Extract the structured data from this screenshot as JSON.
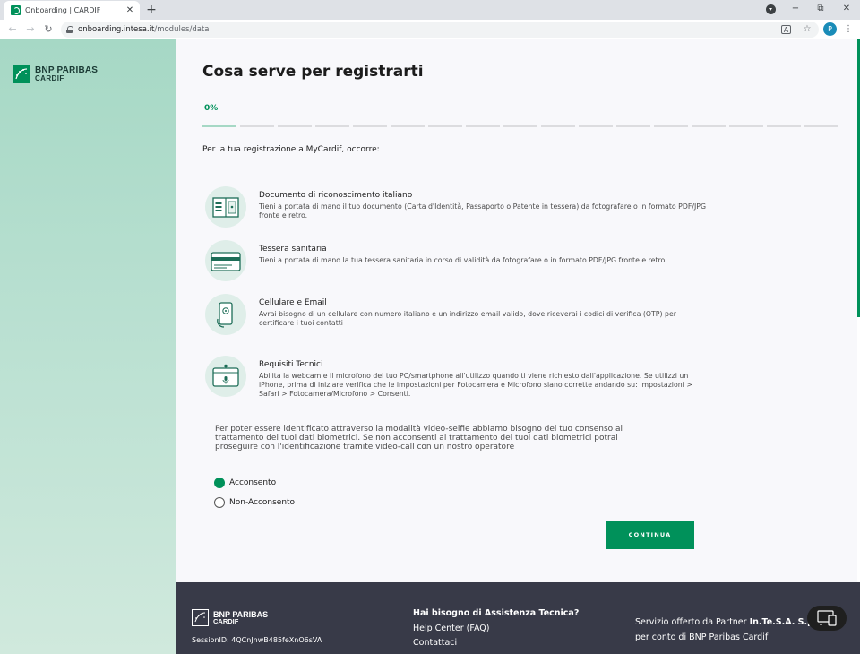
{
  "browser": {
    "tab_title": "Onboarding | CARDIF",
    "url_host": "onboarding.intesa.it",
    "url_path": "/modules/data",
    "profile_initial": "P",
    "icons": {
      "back": "←",
      "forward": "→",
      "reload": "↻",
      "new_tab": "+",
      "close": "✕",
      "minimize": "−",
      "restore": "⧉",
      "window_close": "✕",
      "star": "☆",
      "menu": "⋮",
      "translate": "A"
    }
  },
  "brand": {
    "line1": "BNP PARIBAS",
    "line2": "CARDIF",
    "color": "#00915a"
  },
  "page": {
    "title": "Cosa serve per registrarti",
    "progress": {
      "percent_label": "0%",
      "segments": 17,
      "active_segments": 1
    },
    "intro": "Per la tua registrazione a MyCardif, occorre:",
    "requirements": [
      {
        "icon": "id-document-icon",
        "title": "Documento di riconoscimento italiano",
        "description": "Tieni a portata di mano il tuo documento (Carta d'Identità, Passaporto o Patente in tessera) da fotografare o in formato PDF/JPG fronte e retro."
      },
      {
        "icon": "health-card-icon",
        "title": "Tessera sanitaria",
        "description": "Tieni a portata di mano la tua tessera sanitaria in corso di validità da fotografare o in formato PDF/JPG fronte e retro."
      },
      {
        "icon": "phone-email-icon",
        "title": "Cellulare e Email",
        "description": "Avrai bisogno di un cellulare con numero italiano e un indirizzo email valido, dove riceverai i codici di verifica (OTP) per certificare i tuoi contatti"
      },
      {
        "icon": "webcam-icon",
        "title": "Requisiti Tecnici",
        "description": "Abilita la webcam e il microfono del tuo PC/smartphone all'utilizzo quando ti viene richiesto dall'applicazione. Se utilizzi un iPhone, prima di iniziare verifica che le impostazioni per Fotocamera e Microfono siano corrette andando su: Impostazioni > Safari > Fotocamera/Microfono > Consenti."
      }
    ],
    "consent_text": "Per poter essere identificato attraverso la modalità video-selfie abbiamo bisogno del tuo consenso al trattamento dei tuoi dati biometrici. Se non acconsenti al trattamento dei tuoi dati biometrici potrai proseguire con l'identificazione tramite video-call con un nostro operatore",
    "consent_options": [
      {
        "label": "Acconsento",
        "selected": true
      },
      {
        "label": "Non-Acconsento",
        "selected": false
      }
    ],
    "continue_label": "CONTINUA"
  },
  "footer": {
    "brand_line1": "BNP PARIBAS",
    "brand_line2": "CARDIF",
    "session_id": "SessionID: 4QCnJnwB485feXnO6sVA",
    "help_title": "Hai bisogno di Assistenza Tecnica?",
    "help_links": [
      "Help Center (FAQ)",
      "Contattaci"
    ],
    "partner_prefix": "Servizio offerto da Partner ",
    "partner_name": "In.Te.S.A. S.p.A.",
    "partner_suffix": "per conto di BNP Paribas Cardif"
  }
}
